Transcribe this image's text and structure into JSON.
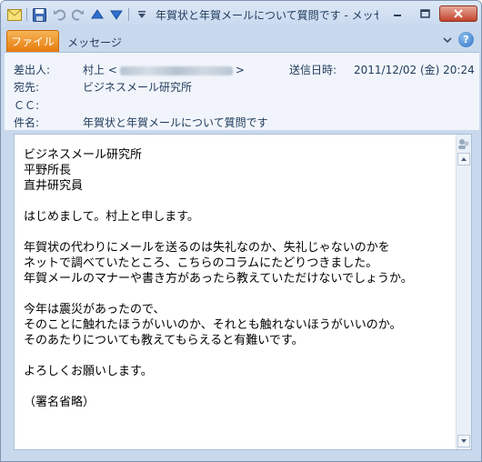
{
  "window": {
    "title": "年賀状と年賀メールについて質問です  -  メッセ..."
  },
  "ribbon": {
    "tabs": [
      "ファイル",
      "メッセージ"
    ]
  },
  "header": {
    "from_label": "差出人:",
    "from_name": "村上 <",
    "from_tail": ">",
    "sent_label": "送信日時:",
    "sent_value": "2011/12/02 (金) 20:24",
    "to_label": "宛先:",
    "to_value": "ビジネスメール研究所",
    "cc_label": "ＣＣ:",
    "subject_label": "件名:",
    "subject_value": "年賀状と年賀メールについて質問です"
  },
  "body": {
    "text": "ビジネスメール研究所\n平野所長\n直井研究員\n\nはじめまして。村上と申します。\n\n年賀状の代わりにメールを送るのは失礼なのか、失礼じゃないのかを\nネットで調べていたところ、こちらのコラムにたどりつきました。\n年賀メールのマナーや書き方があったら教えていただけないでしょうか。\n\n今年は震災があったので、\nそのことに触れたほうがいいのか、それとも触れないほうがいいのか。\nそのあたりについても教えてもらえると有難いです。\n\nよろしくお願いします。\n\n（署名省略）"
  },
  "colors": {
    "file_tab": "#e77b0d",
    "chrome": "#c9d9ed",
    "text": "#1e395b"
  }
}
